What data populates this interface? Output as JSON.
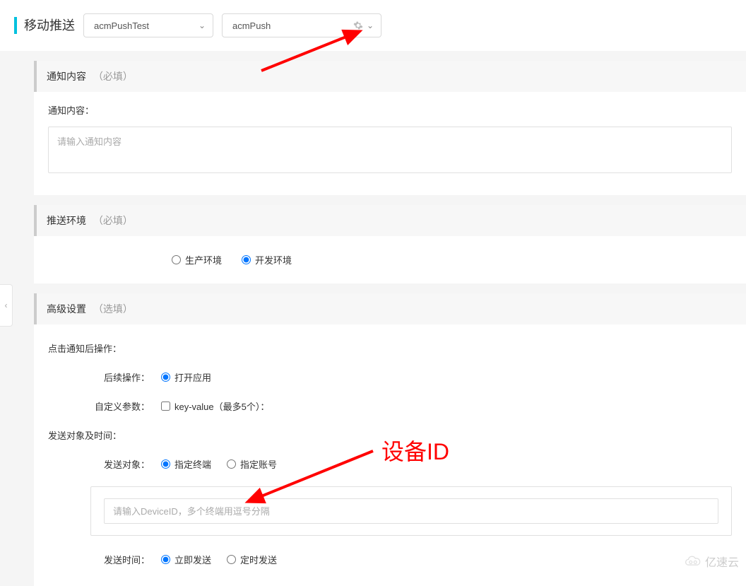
{
  "topbar": {
    "title": "移动推送",
    "dropdown1": "acmPushTest",
    "dropdown2": "acmPush"
  },
  "sections": {
    "notify": {
      "title": "通知内容",
      "required": "（必填）",
      "label": "通知内容：",
      "placeholder": "请输入通知内容"
    },
    "env": {
      "title": "推送环境",
      "required": "（必填）",
      "opt_prod": "生产环境",
      "opt_dev": "开发环境"
    },
    "advanced": {
      "title": "高级设置",
      "optional": "（选填）",
      "after_click_label": "点击通知后操作：",
      "followup_label": "后续操作：",
      "followup_open_app": "打开应用",
      "custom_params_label": "自定义参数：",
      "custom_params_value": "key-value（最多5个）：",
      "target_time_label": "发送对象及时间：",
      "target_label": "发送对象：",
      "target_device": "指定终端",
      "target_account": "指定账号",
      "device_placeholder": "请输入DeviceID，多个终端用逗号分隔",
      "send_time_label": "发送时间：",
      "send_now": "立即发送",
      "send_scheduled": "定时发送"
    }
  },
  "annotations": {
    "device_id_label": "设备ID"
  },
  "watermark": "亿速云"
}
